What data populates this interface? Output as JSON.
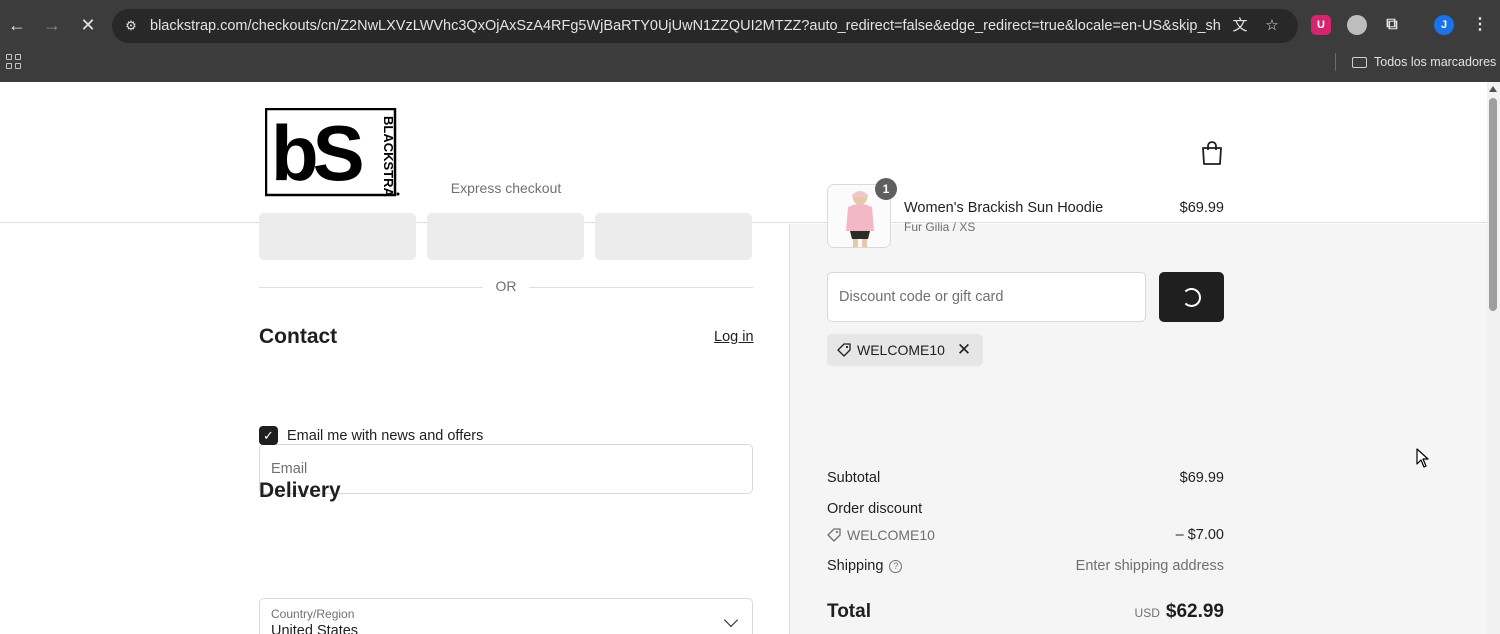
{
  "browser": {
    "url": "blackstrap.com/checkouts/cn/Z2NwLXVzLWVhc3QxOjAxSzA4RFg5WjBaRTY0UjUwN1ZZQUI2MTZZ?auto_redirect=false&edge_redirect=true&locale=en-US&skip_shop_pay=true",
    "bookmarks_all": "Todos los marcadores",
    "profile_initial": "J",
    "extension_u": "U"
  },
  "header": {
    "logo_text": "bS",
    "logo_side_text": "BLACKSTRAP"
  },
  "express": {
    "title": "Express checkout",
    "or_text": "OR"
  },
  "contact": {
    "title": "Contact",
    "login_link": "Log in",
    "email_placeholder": "Email",
    "newsletter_label": "Email me with news and offers",
    "newsletter_checked": true
  },
  "delivery": {
    "title": "Delivery",
    "country_label": "Country/Region",
    "country_value": "United States"
  },
  "summary": {
    "product": {
      "quantity": "1",
      "name": "Women's Brackish Sun Hoodie",
      "variant": "Fur Gilia / XS",
      "price": "$69.99"
    },
    "discount_placeholder": "Discount code or gift card",
    "applied_code": "WELCOME10",
    "subtotal_label": "Subtotal",
    "subtotal_value": "$69.99",
    "order_discount_label": "Order discount",
    "order_discount_code": "WELCOME10",
    "order_discount_value": "– $7.00",
    "shipping_label": "Shipping",
    "shipping_value": "Enter shipping address",
    "total_label": "Total",
    "total_currency": "USD",
    "total_value": "$62.99"
  },
  "colors": {
    "chrome_bg": "#3c3c3c",
    "panel_bg": "#f5f5f5",
    "button_dark": "#1f1f1f",
    "ext_u_color": "#d6246e",
    "profile_color": "#1a73e8"
  }
}
